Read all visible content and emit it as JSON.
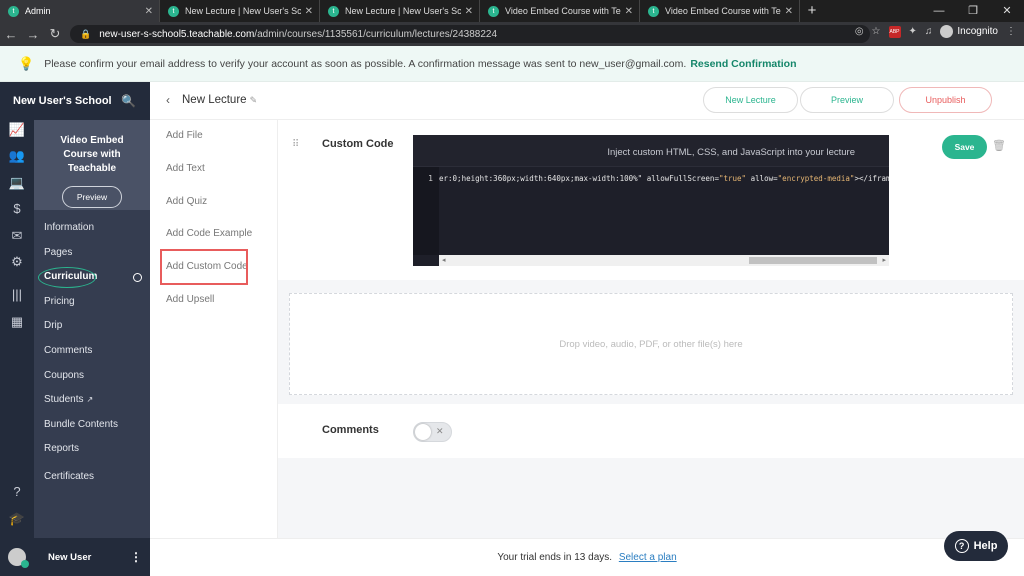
{
  "browser": {
    "tabs": [
      {
        "title": "Admin",
        "active": true
      },
      {
        "title": "New Lecture | New User's Sc"
      },
      {
        "title": "New Lecture | New User's School"
      },
      {
        "title": "Video Embed Course with Teacha"
      },
      {
        "title": "Video Embed Course with Teacha"
      }
    ],
    "new_tab": "+",
    "url_host": "new-user-s-school5.teachable.com",
    "url_path": "/admin/courses/1135561/curriculum/lectures/24388224",
    "profile": "Incognito"
  },
  "banner": {
    "message": "Please confirm your email address to verify your account as soon as possible. A confirmation message was sent to new_user@gmail.com.",
    "link": "Resend Confirmation"
  },
  "school": {
    "name": "New User's School"
  },
  "course": {
    "title": "Video Embed Course with Teachable",
    "preview_label": "Preview"
  },
  "menu": [
    {
      "label": "Information"
    },
    {
      "label": "Pages"
    },
    {
      "label": "Curriculum",
      "active": true
    },
    {
      "label": "Pricing"
    },
    {
      "label": "Drip"
    },
    {
      "label": "Comments"
    },
    {
      "label": "Coupons"
    },
    {
      "label": "Students"
    },
    {
      "label": "Bundle Contents"
    },
    {
      "label": "Reports"
    },
    {
      "label": "Certificates"
    }
  ],
  "user": {
    "name": "New User"
  },
  "toolbar": {
    "lecture_title": "New Lecture",
    "new_lecture": "New Lecture",
    "preview": "Preview",
    "unpublish": "Unpublish"
  },
  "blocks": [
    "Add File",
    "Add Text",
    "Add Quiz",
    "Add Code Example",
    "Add Custom Code",
    "Add Upsell"
  ],
  "custom_code": {
    "label": "Custom Code",
    "editor_hint": "Inject custom HTML, CSS, and JavaScript into your lecture",
    "line_number": "1",
    "code_a": "er:0;height:360px;width:640px;max-width:100%\" allowFullScreen=",
    "code_b": "\"true\"",
    "code_c": " allow=",
    "code_d": "\"encrypted-media\"",
    "code_e": "></iframe>",
    "save": "Save"
  },
  "dropzone": {
    "text": "Drop video, audio, PDF, or other file(s) here"
  },
  "comments": {
    "label": "Comments",
    "enabled": false
  },
  "trial": {
    "text": "Your trial ends in 13 days.",
    "link": "Select a plan"
  },
  "help": {
    "label": "Help"
  },
  "colors": {
    "accent": "#2bb58f",
    "danger": "#e85c5c",
    "sidebar": "#232b3b",
    "highlight_box": "#e85c5c"
  }
}
